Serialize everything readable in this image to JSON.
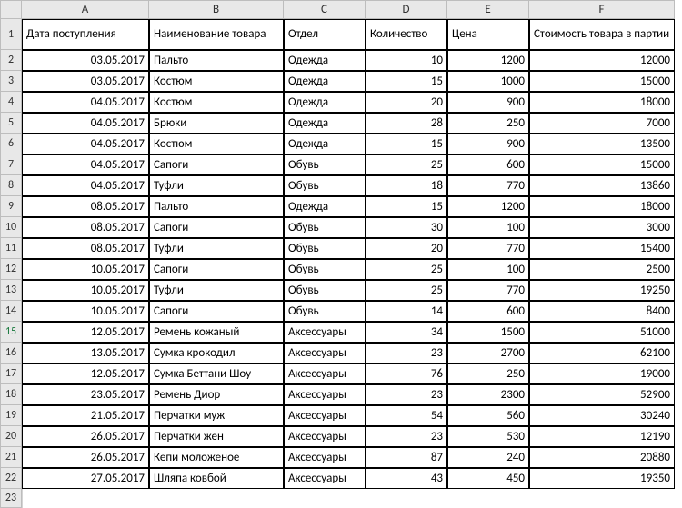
{
  "columns": [
    "",
    "A",
    "B",
    "C",
    "D",
    "E",
    "F"
  ],
  "headers": [
    "Дата поступления",
    "Наименование товара",
    "Отдел",
    "Количество",
    "Цена",
    "Стоимость товара в партии"
  ],
  "rows": [
    {
      "n": 1,
      "date": "",
      "name": "",
      "dept": "",
      "qty": "",
      "price": "",
      "cost": ""
    },
    {
      "n": 2,
      "date": "03.05.2017",
      "name": "Пальто",
      "dept": "Одежда",
      "qty": 10,
      "price": 1200,
      "cost": 12000
    },
    {
      "n": 3,
      "date": "03.05.2017",
      "name": "Костюм",
      "dept": "Одежда",
      "qty": 15,
      "price": 1000,
      "cost": 15000
    },
    {
      "n": 4,
      "date": "04.05.2017",
      "name": "Костюм",
      "dept": "Одежда",
      "qty": 20,
      "price": 900,
      "cost": 18000
    },
    {
      "n": 5,
      "date": "04.05.2017",
      "name": "Брюки",
      "dept": "Одежда",
      "qty": 28,
      "price": 250,
      "cost": 7000
    },
    {
      "n": 6,
      "date": "04.05.2017",
      "name": "Костюм",
      "dept": "Одежда",
      "qty": 15,
      "price": 900,
      "cost": 13500
    },
    {
      "n": 7,
      "date": "04.05.2017",
      "name": "Сапоги",
      "dept": "Обувь",
      "qty": 25,
      "price": 600,
      "cost": 15000
    },
    {
      "n": 8,
      "date": "04.05.2017",
      "name": "Туфли",
      "dept": "Обувь",
      "qty": 18,
      "price": 770,
      "cost": 13860
    },
    {
      "n": 9,
      "date": "08.05.2017",
      "name": "Пальто",
      "dept": "Одежда",
      "qty": 15,
      "price": 1200,
      "cost": 18000
    },
    {
      "n": 10,
      "date": "08.05.2017",
      "name": "Сапоги",
      "dept": "Обувь",
      "qty": 30,
      "price": 100,
      "cost": 3000
    },
    {
      "n": 11,
      "date": "08.05.2017",
      "name": "Туфли",
      "dept": "Обувь",
      "qty": 20,
      "price": 770,
      "cost": 15400
    },
    {
      "n": 12,
      "date": "10.05.2017",
      "name": "Сапоги",
      "dept": "Обувь",
      "qty": 25,
      "price": 100,
      "cost": 2500
    },
    {
      "n": 13,
      "date": "10.05.2017",
      "name": "Туфли",
      "dept": "Обувь",
      "qty": 25,
      "price": 770,
      "cost": 19250
    },
    {
      "n": 14,
      "date": "10.05.2017",
      "name": "Сапоги",
      "dept": "Обувь",
      "qty": 14,
      "price": 600,
      "cost": 8400
    },
    {
      "n": 15,
      "date": "12.05.2017",
      "name": "Ремень кожаный",
      "dept": "Аксессуары",
      "qty": 34,
      "price": 1500,
      "cost": 51000
    },
    {
      "n": 16,
      "date": "13.05.2017",
      "name": "Сумка крокодил",
      "dept": "Аксессуары",
      "qty": 23,
      "price": 2700,
      "cost": 62100
    },
    {
      "n": 17,
      "date": "12.05.2017",
      "name": "Сумка Беттани Шоу",
      "dept": "Аксессуары",
      "qty": 76,
      "price": 250,
      "cost": 19000
    },
    {
      "n": 18,
      "date": "23.05.2017",
      "name": "Ремень Диор",
      "dept": "Аксессуары",
      "qty": 23,
      "price": 2300,
      "cost": 52900
    },
    {
      "n": 19,
      "date": "21.05.2017",
      "name": "Перчатки муж",
      "dept": "Аксессуары",
      "qty": 54,
      "price": 560,
      "cost": 30240
    },
    {
      "n": 20,
      "date": "26.05.2017",
      "name": "Перчатки жен",
      "dept": "Аксессуары",
      "qty": 23,
      "price": 530,
      "cost": 12190
    },
    {
      "n": 21,
      "date": "26.05.2017",
      "name": "Кепи моложеное",
      "dept": "Аксессуары",
      "qty": 87,
      "price": 240,
      "cost": 20880
    },
    {
      "n": 22,
      "date": "27.05.2017",
      "name": "Шляпа ковбой",
      "dept": "Аксессуары",
      "qty": 43,
      "price": 450,
      "cost": 19350
    }
  ],
  "emptyRow": 23
}
